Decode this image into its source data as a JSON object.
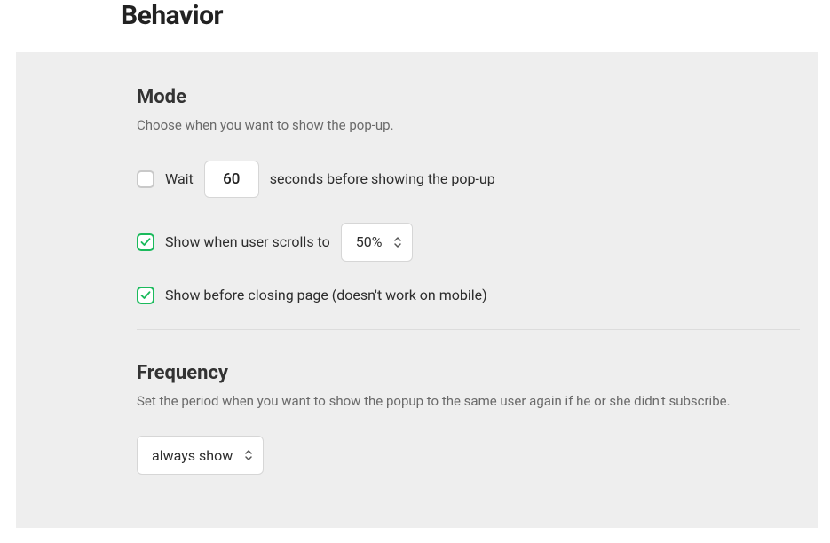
{
  "header": {
    "title": "Behavior"
  },
  "mode": {
    "title": "Mode",
    "desc": "Choose when you want to show the pop-up.",
    "wait": {
      "label_before": "Wait",
      "value": "60",
      "label_after": "seconds before showing the pop-up"
    },
    "scroll": {
      "label": "Show when user scrolls to",
      "value": "50%"
    },
    "exit": {
      "label": "Show before closing page (doesn't work on mobile)"
    }
  },
  "frequency": {
    "title": "Frequency",
    "desc": "Set the period when you want to show the popup to the same user again if he or she didn't subscribe.",
    "value": "always show"
  }
}
